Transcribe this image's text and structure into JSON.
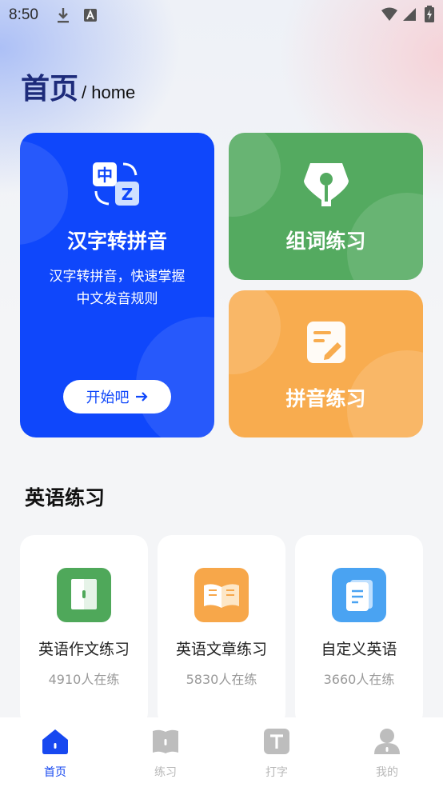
{
  "status_bar": {
    "time": "8:50"
  },
  "header": {
    "title": "首页",
    "subtitle": "/ home"
  },
  "cards": {
    "hanzi": {
      "title": "汉字转拼音",
      "desc_line1": "汉字转拼音，快速掌握",
      "desc_line2": "中文发音规则",
      "button": "开始吧"
    },
    "words": {
      "title": "组词练习"
    },
    "pinyin": {
      "title": "拼音练习"
    }
  },
  "english_section": {
    "title": "英语练习",
    "items": [
      {
        "name": "英语作文练习",
        "count": "4910人在练",
        "color": "#4fa85a"
      },
      {
        "name": "英语文章练习",
        "count": "5830人在练",
        "color": "#f7a74a"
      },
      {
        "name": "自定义英语",
        "count": "3660人在练",
        "color": "#4aa3f2"
      }
    ]
  },
  "tabbar": {
    "tabs": [
      {
        "label": "首页",
        "active": true
      },
      {
        "label": "练习",
        "active": false
      },
      {
        "label": "打字",
        "active": false
      },
      {
        "label": "我的",
        "active": false
      }
    ],
    "active_color": "#1748f0",
    "inactive_color": "#b8b8b8"
  },
  "colors": {
    "primary": "#0f47fb",
    "green": "#54aa60",
    "orange": "#f8ac4f"
  }
}
